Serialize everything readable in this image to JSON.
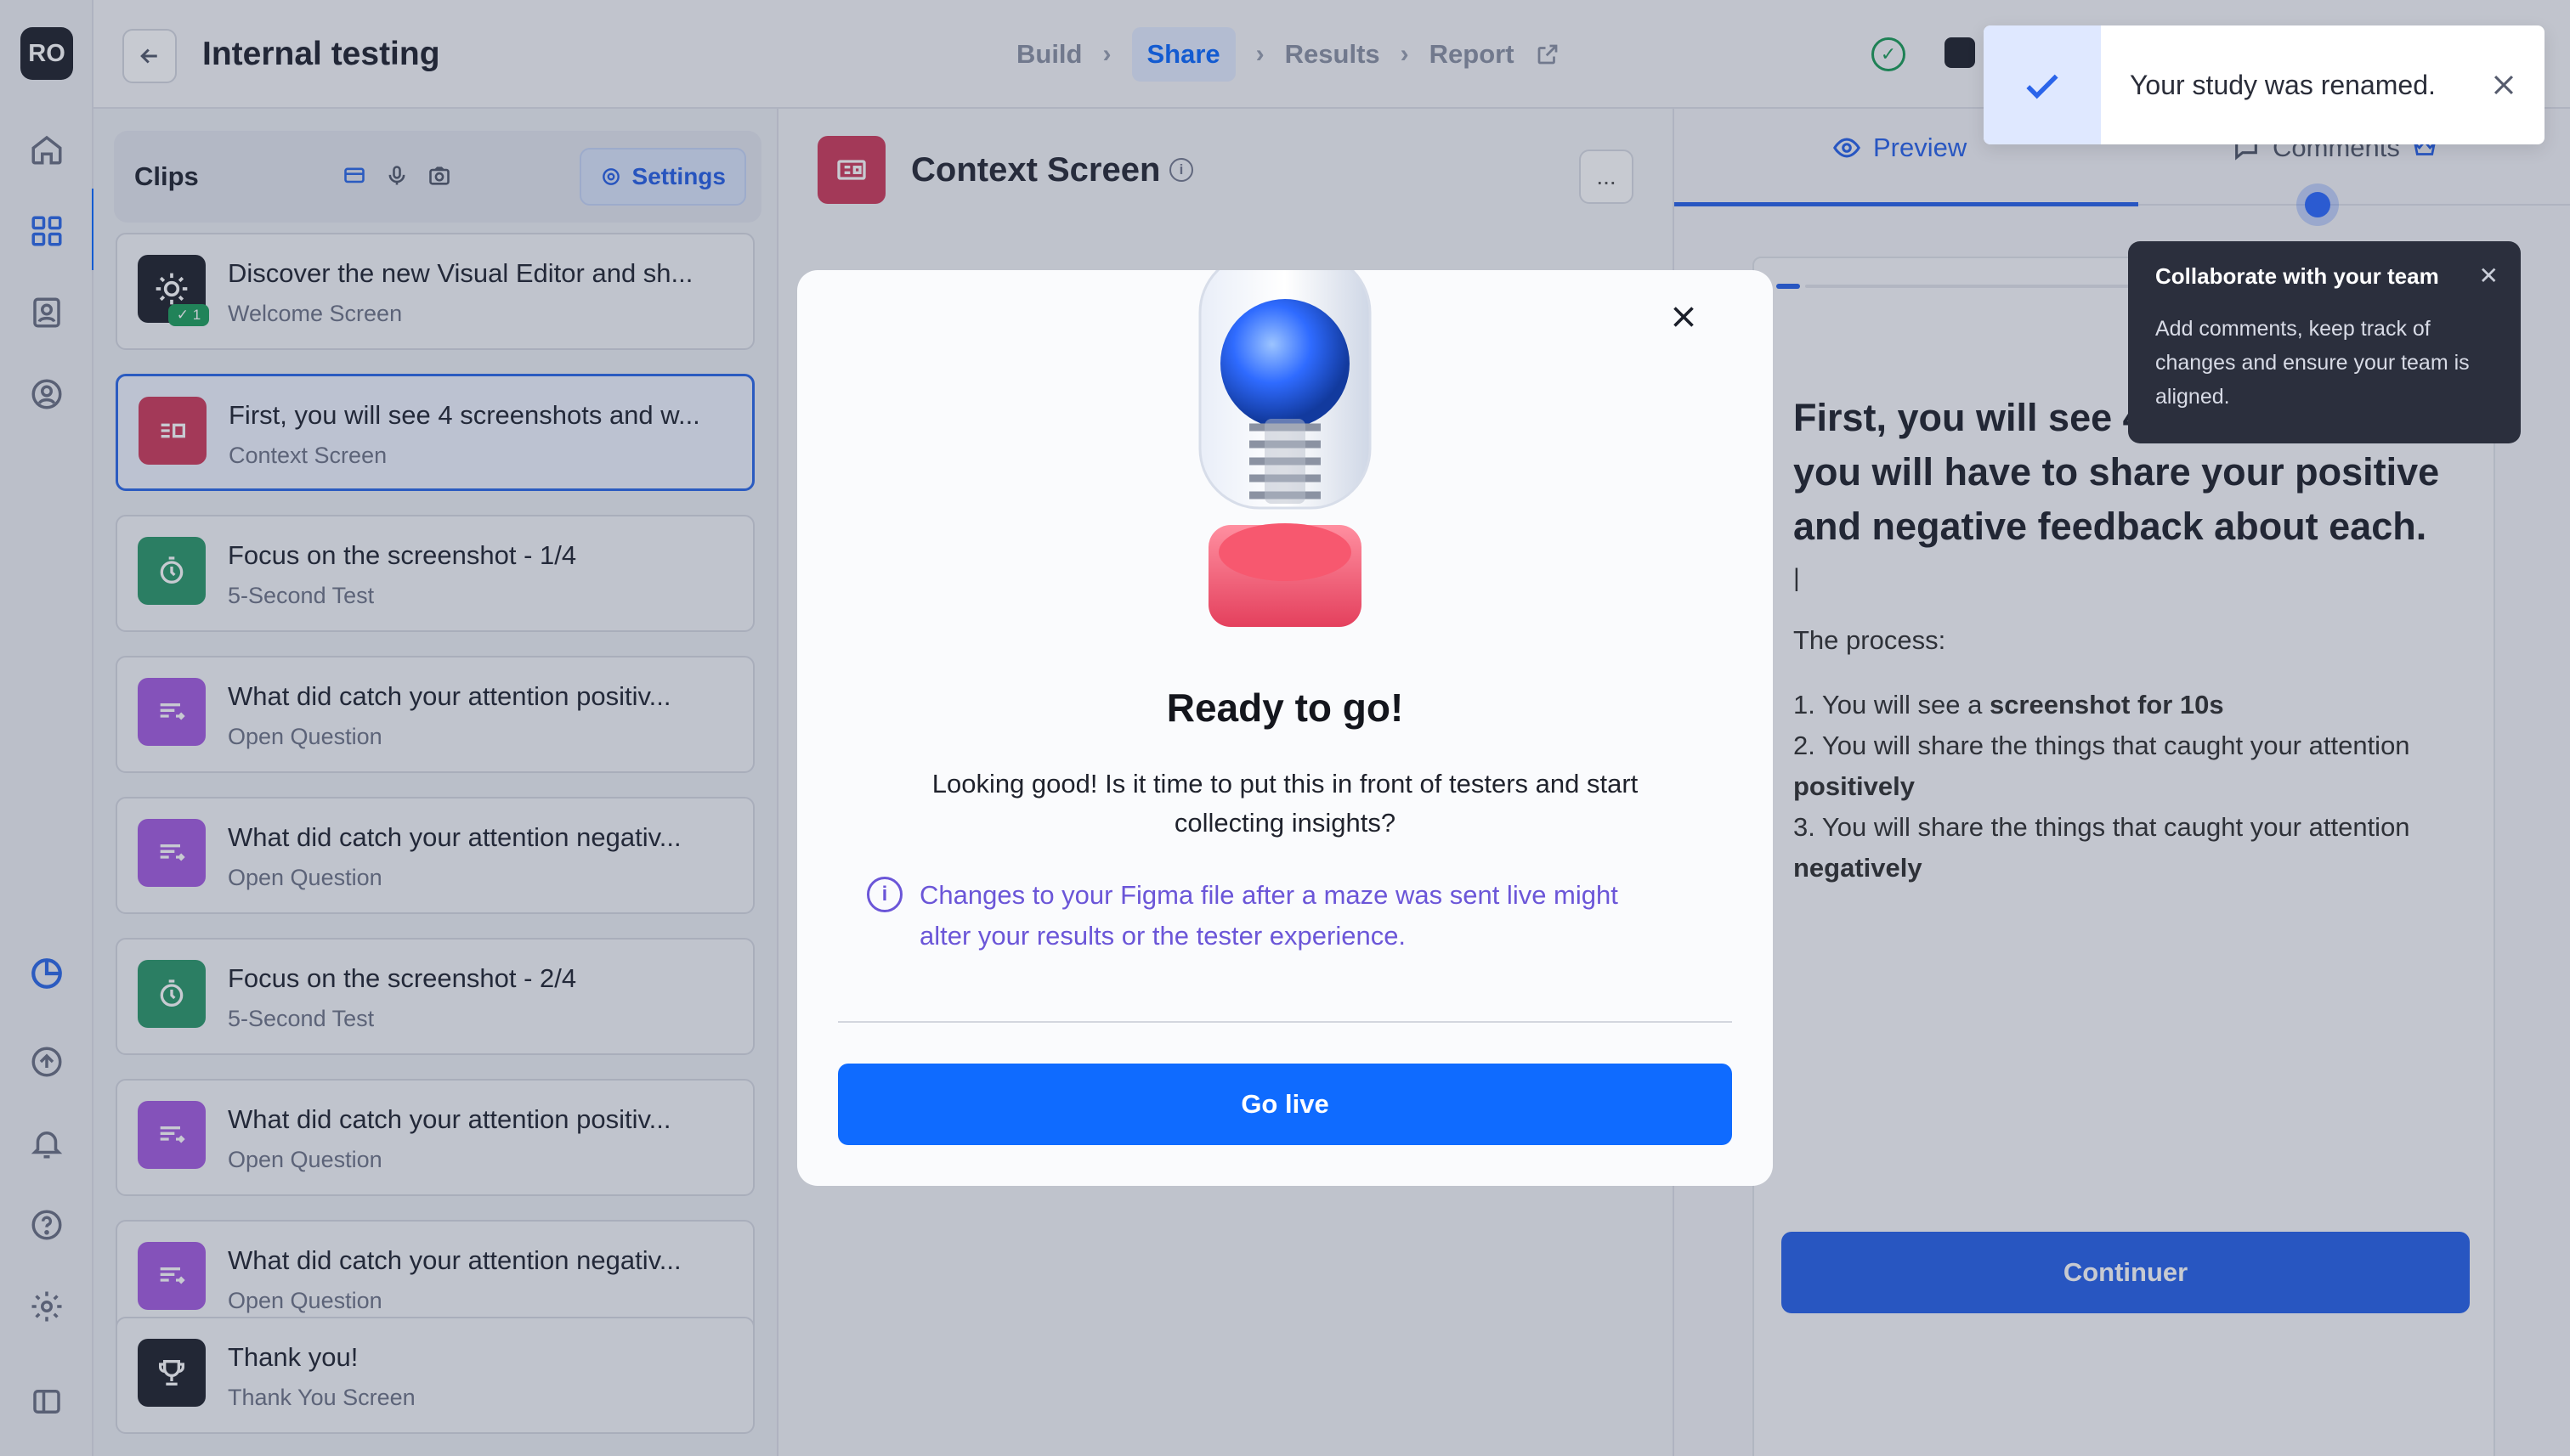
{
  "app": {
    "avatar_initials": "RO",
    "accent": "#0f6bff"
  },
  "header": {
    "title": "Internal testing",
    "steps": [
      {
        "label": "Build",
        "active": false
      },
      {
        "label": "Share",
        "active": true
      },
      {
        "label": "Results",
        "active": false
      },
      {
        "label": "Report",
        "active": false
      }
    ]
  },
  "rail": {
    "top_icons": [
      "home-icon",
      "grid-icon",
      "contacts-icon",
      "user-settings-icon"
    ],
    "bottom_icons": [
      "pie-chart-icon",
      "upload-icon",
      "bell-icon",
      "help-icon",
      "gear-icon",
      "sidebar-toggle-icon"
    ]
  },
  "clips": {
    "title": "Clips",
    "settings_label": "Settings",
    "tool_icons": [
      "screen-record-icon",
      "microphone-icon",
      "camera-icon"
    ],
    "items": [
      {
        "title": "Discover the new Visual Editor and sh...",
        "subtitle": "Welcome Screen",
        "icon": "sun-icon",
        "color": "#23262f",
        "badge": "✓ 1"
      },
      {
        "title": "First, you will see 4 screenshots and w...",
        "subtitle": "Context Screen",
        "icon": "context-icon",
        "color": "#cf3e5e",
        "selected": true
      },
      {
        "title": "Focus on the screenshot - 1/4",
        "subtitle": "5-Second Test",
        "icon": "timer-icon",
        "color": "#2f9a6c"
      },
      {
        "title": "What did catch your attention positiv...",
        "subtitle": "Open Question",
        "icon": "open-question-icon",
        "color": "#a65fe0"
      },
      {
        "title": "What did catch your attention negativ...",
        "subtitle": "Open Question",
        "icon": "open-question-icon",
        "color": "#a65fe0"
      },
      {
        "title": "Focus on the screenshot - 2/4",
        "subtitle": "5-Second Test",
        "icon": "timer-icon",
        "color": "#2f9a6c"
      },
      {
        "title": "What did catch your attention positiv...",
        "subtitle": "Open Question",
        "icon": "open-question-icon",
        "color": "#a65fe0"
      },
      {
        "title": "What did catch your attention negativ...",
        "subtitle": "Open Question",
        "icon": "open-question-icon",
        "color": "#a65fe0"
      },
      {
        "title": "Thank you!",
        "subtitle": "Thank You Screen",
        "icon": "trophy-icon",
        "color": "#23262f"
      }
    ]
  },
  "center": {
    "title": "Context Screen",
    "more_label": "..."
  },
  "right": {
    "tabs": [
      {
        "label": "Preview"
      },
      {
        "label": "Comments"
      }
    ],
    "preview_title": "First, you will see 4 screenshots and you will have to share your positive and negative feedback about each.",
    "cursor": "|",
    "process_label": "The process:",
    "process_items": [
      {
        "prefix": "1. You will see a ",
        "bold": "screenshot for 10s"
      },
      {
        "prefix": "2. You will share the things that caught your attention ",
        "bold": "positively"
      },
      {
        "prefix": "3. You will share the things that caught your attention ",
        "bold": "negatively"
      }
    ],
    "continue_label": "Continuer"
  },
  "tooltip": {
    "title": "Collaborate with your team",
    "body": "Add comments, keep track of changes and ensure your team is aligned."
  },
  "modal": {
    "title": "Ready to go!",
    "body": "Looking good! Is it time to put this in front of testers and start collecting insights?",
    "info": "Changes to your Figma file after a maze was sent live might alter your results or the tester experience.",
    "button_label": "Go live",
    "info_color": "#6b56d8"
  },
  "toast": {
    "message": "Your study was renamed."
  }
}
